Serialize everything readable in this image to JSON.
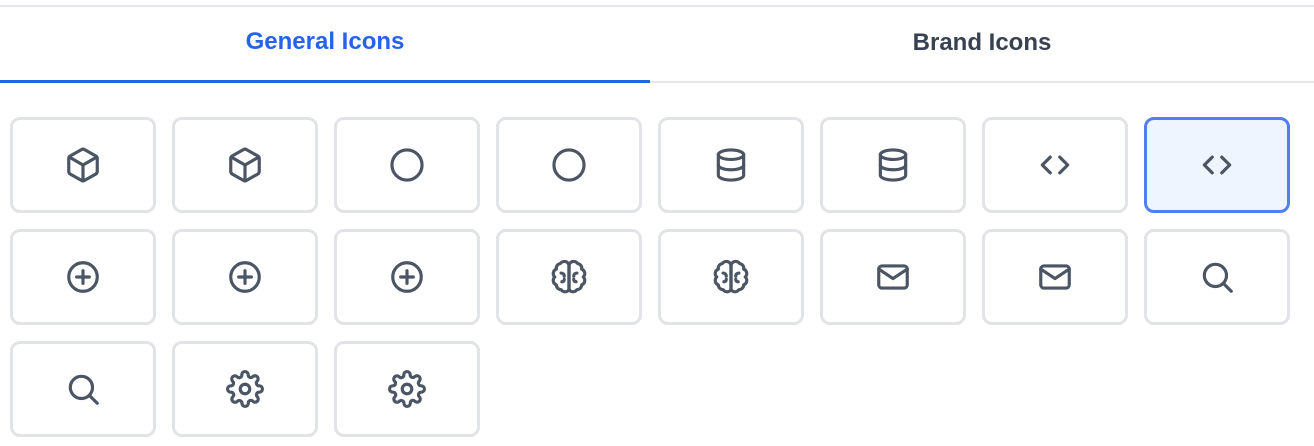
{
  "tabs": [
    {
      "label": "General Icons",
      "active": true
    },
    {
      "label": "Brand Icons",
      "active": false
    }
  ],
  "accent_color": "#2563eb",
  "icons": [
    {
      "name": "cube-icon",
      "selected": false
    },
    {
      "name": "cube-icon",
      "selected": false
    },
    {
      "name": "circle-icon",
      "selected": false
    },
    {
      "name": "circle-icon",
      "selected": false
    },
    {
      "name": "database-icon",
      "selected": false
    },
    {
      "name": "database-icon",
      "selected": false
    },
    {
      "name": "code-icon",
      "selected": false
    },
    {
      "name": "code-icon",
      "selected": true
    },
    {
      "name": "plus-circle-icon",
      "selected": false
    },
    {
      "name": "plus-circle-icon",
      "selected": false
    },
    {
      "name": "plus-circle-icon",
      "selected": false
    },
    {
      "name": "brain-icon",
      "selected": false
    },
    {
      "name": "brain-icon",
      "selected": false
    },
    {
      "name": "mail-icon",
      "selected": false
    },
    {
      "name": "mail-icon",
      "selected": false
    },
    {
      "name": "search-icon",
      "selected": false
    },
    {
      "name": "search-icon",
      "selected": false
    },
    {
      "name": "gear-icon",
      "selected": false
    },
    {
      "name": "gear-icon",
      "selected": false
    }
  ]
}
